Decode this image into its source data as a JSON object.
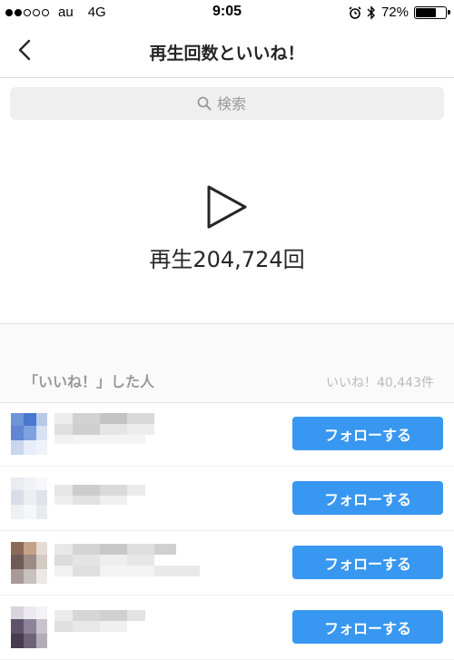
{
  "status_bar": {
    "carrier": "au",
    "network": "4G",
    "time": "9:05",
    "battery": "72%",
    "battery_level": 0.72
  },
  "nav": {
    "title": "再生回数といいね！",
    "back_icon": "chevron-left-icon"
  },
  "search": {
    "placeholder": "検索"
  },
  "video": {
    "play_count_text": "再生204,724回"
  },
  "likers": {
    "title": "「いいね！」した人",
    "count_text": "いいね！40,443件"
  },
  "users": [
    {
      "follow_label": "フォローする"
    },
    {
      "follow_label": "フォローする"
    },
    {
      "follow_label": "フォローする"
    },
    {
      "follow_label": "フォローする"
    }
  ],
  "colors": {
    "accent": "#3897f0",
    "text": "#262626",
    "muted": "#999999"
  }
}
